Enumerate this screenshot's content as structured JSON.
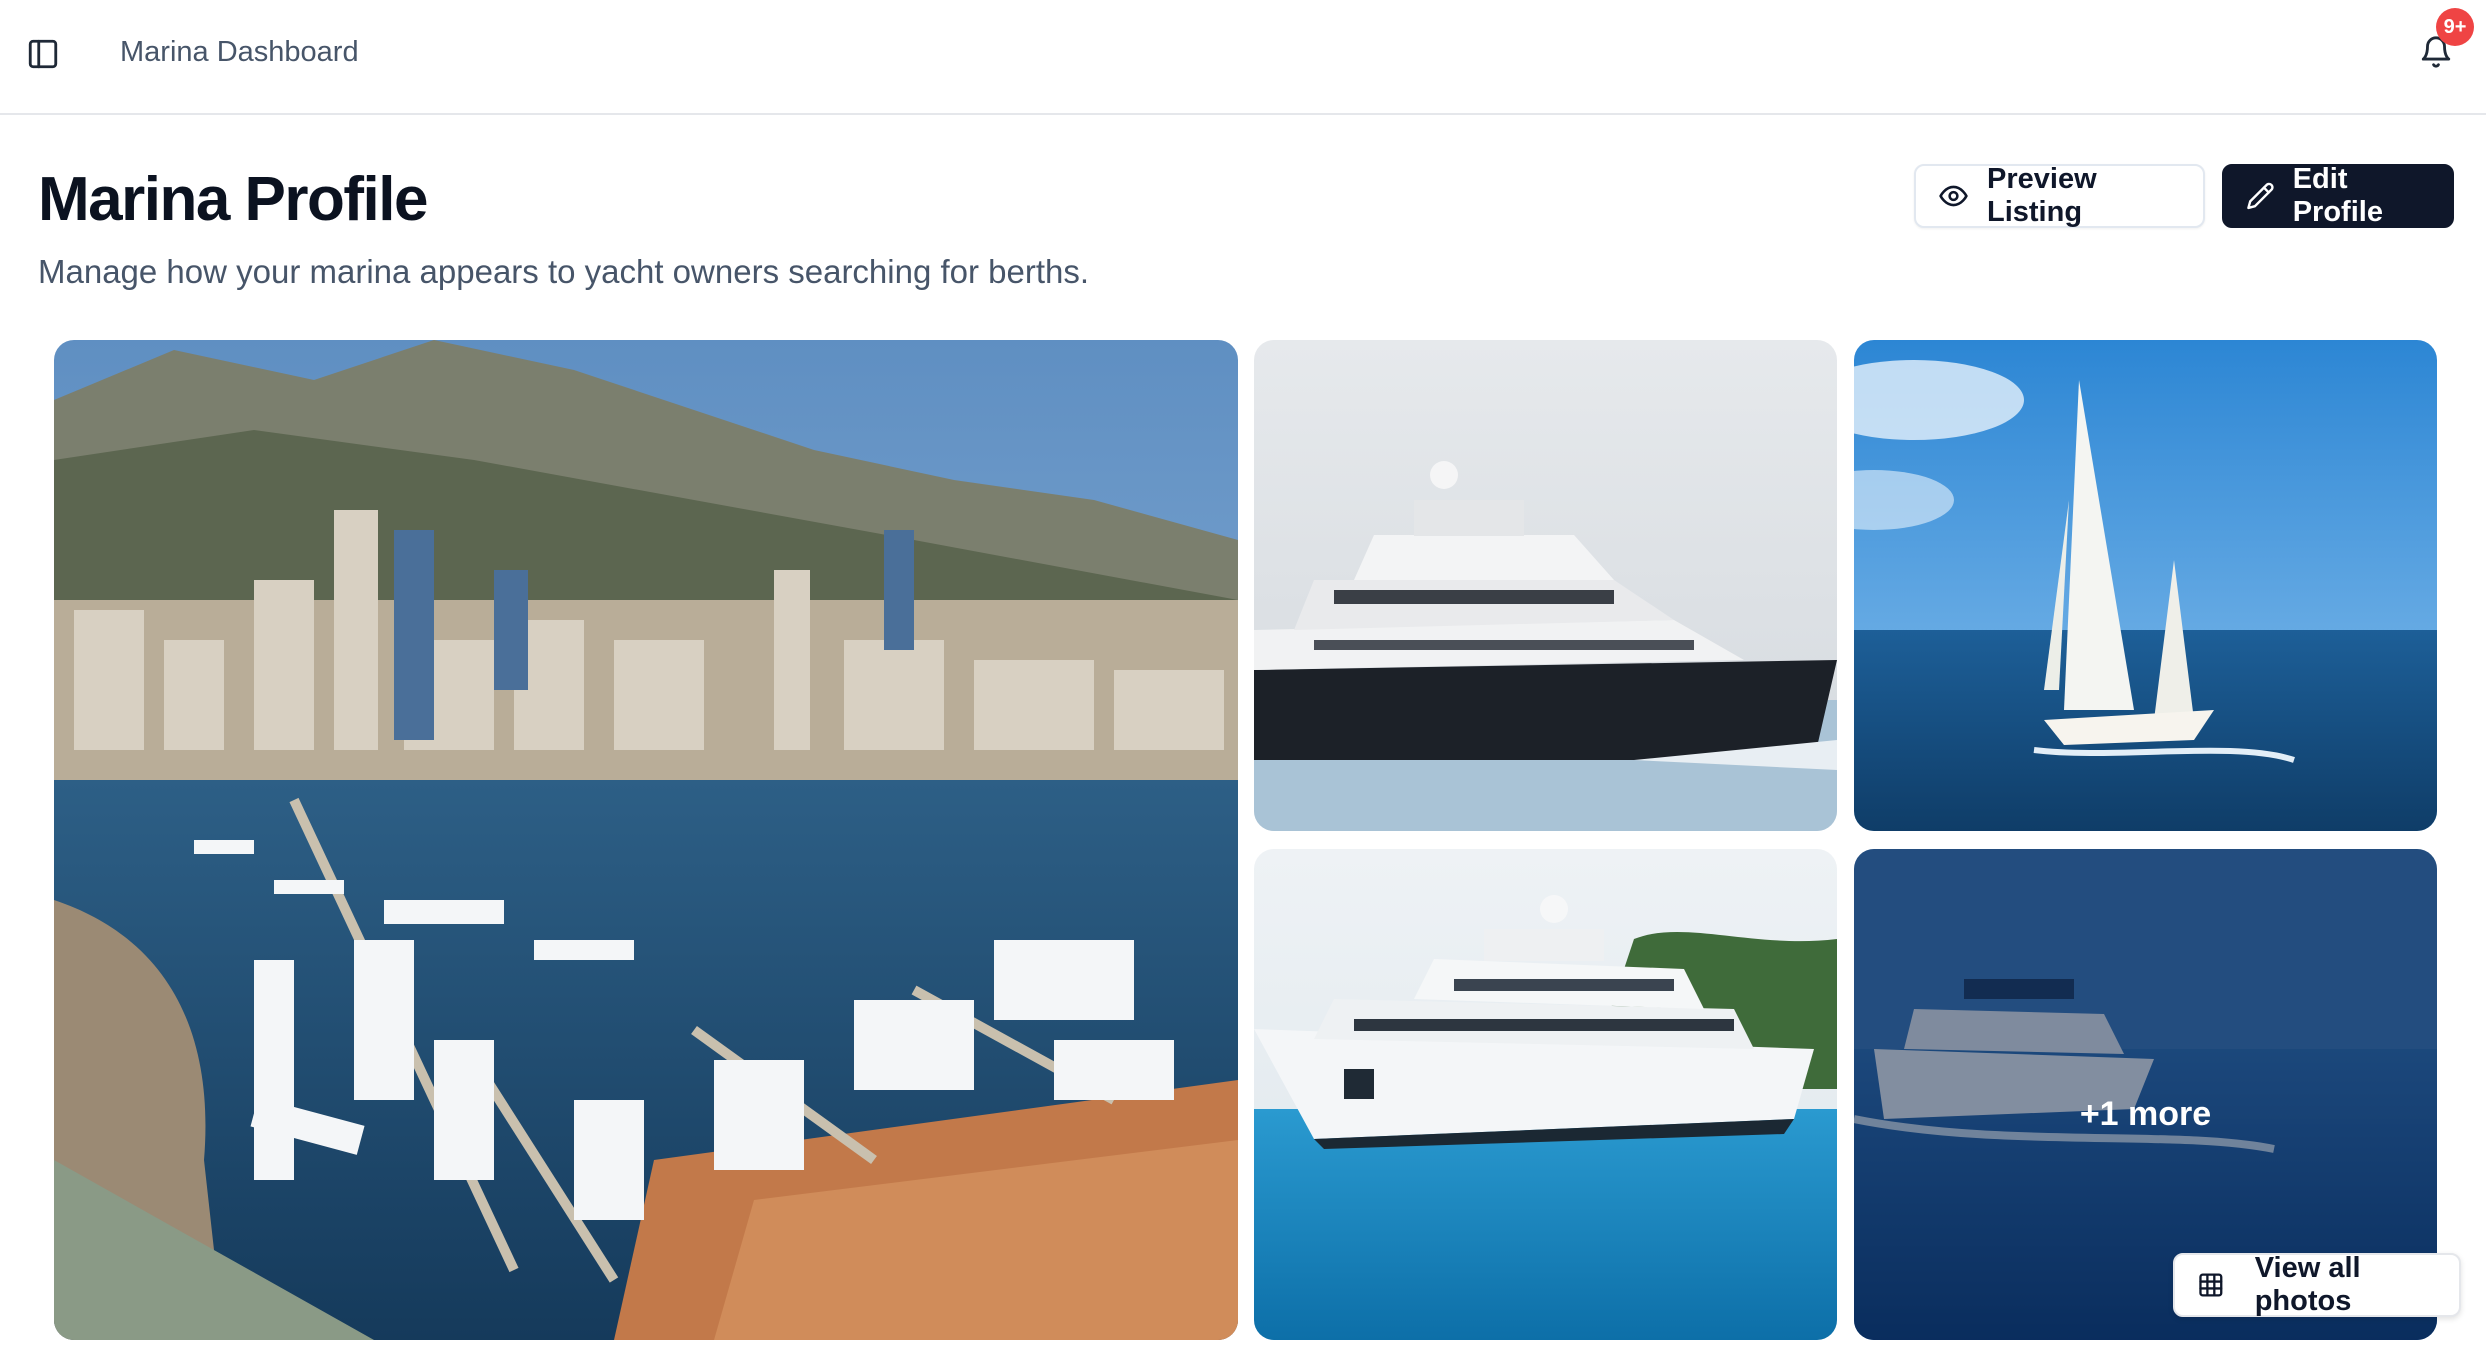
{
  "header": {
    "breadcrumb": "Marina Dashboard",
    "notification_count": "9+"
  },
  "page": {
    "title": "Marina Profile",
    "subtitle": "Manage how your marina appears to yacht owners searching for berths."
  },
  "actions": {
    "preview_label": "Preview Listing",
    "edit_label": "Edit Profile"
  },
  "gallery": {
    "more_label": "+1 more",
    "view_all_label": "View all photos"
  },
  "icons": {
    "sidebar": "sidebar-toggle-icon",
    "bell": "bell-icon",
    "eye": "eye-icon",
    "pencil": "pencil-icon",
    "grid": "grid-icon"
  },
  "colors": {
    "primary_dark": "#0f172a",
    "badge": "#ef4444",
    "muted_text": "#475569"
  }
}
